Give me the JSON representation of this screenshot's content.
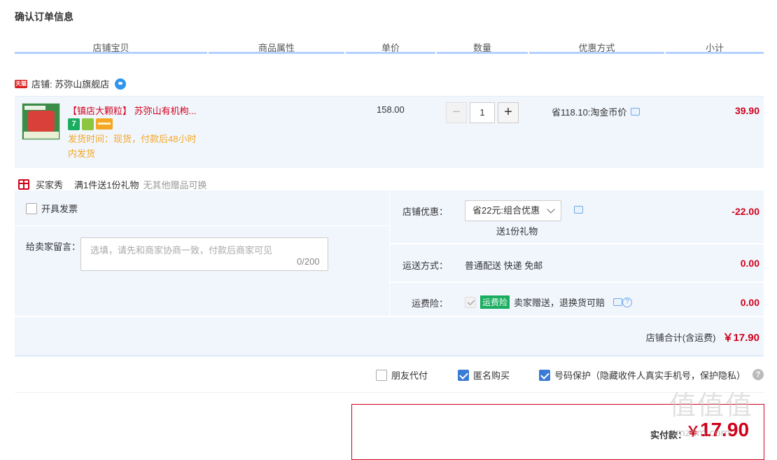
{
  "page_title": "确认订单信息",
  "columns": [
    "店铺宝贝",
    "商品属性",
    "单价",
    "数量",
    "优惠方式",
    "小计"
  ],
  "shop": {
    "badge": "天猫",
    "label": "店铺: 苏弥山旗舰店"
  },
  "item": {
    "title": "【镇店大颗粒】 苏弥山有机枸...",
    "badges": [
      "7",
      "shield-icon",
      "card-icon"
    ],
    "ship_time": "发货时间：现货，付款后48小时内发货",
    "price": "158.00",
    "quantity": "1",
    "minus": "−",
    "plus": "+",
    "discount": "省118.10:淘金币价",
    "subtotal": "39.90"
  },
  "gift": {
    "label": "买家秀",
    "rule": "满1件送1份礼物",
    "note": "无其他赠品可换"
  },
  "invoice": {
    "label": "开具发票",
    "checked": false
  },
  "memo": {
    "label": "给卖家留言：",
    "placeholder": "选填，请先和商家协商一致，付款后商家可见",
    "count": "0/200"
  },
  "shop_discount": {
    "label": "店铺优惠：",
    "selected": "省22元:组合优惠",
    "sub": "送1份礼物",
    "amount": "-22.00"
  },
  "shipping": {
    "label": "运送方式：",
    "value": "普通配送 快递 免邮",
    "amount": "0.00"
  },
  "insurance": {
    "label": "运费险：",
    "tag": "运费险",
    "text": "卖家赠送，退换货可赔",
    "amount": "0.00"
  },
  "shop_total": {
    "label": "店铺合计(含运费)",
    "amount": "￥17.90"
  },
  "options": {
    "friend_pay": "朋友代付",
    "anonymous": "匿名购买",
    "number_protect": "号码保护（隐藏收件人真实手机号，保护隐私）",
    "help": "?"
  },
  "payment": {
    "label": "实付款：",
    "yen": "￥",
    "amount": "17.90"
  },
  "watermark": {
    "big": "值值值",
    "small": "smzdm.com"
  },
  "colors": {
    "accent_red": "#d0021b",
    "header_line": "#b2d1ff",
    "panel_bg": "#f1f6fd",
    "ship_orange": "#f5a623",
    "check_blue": "#3a7bd5"
  }
}
